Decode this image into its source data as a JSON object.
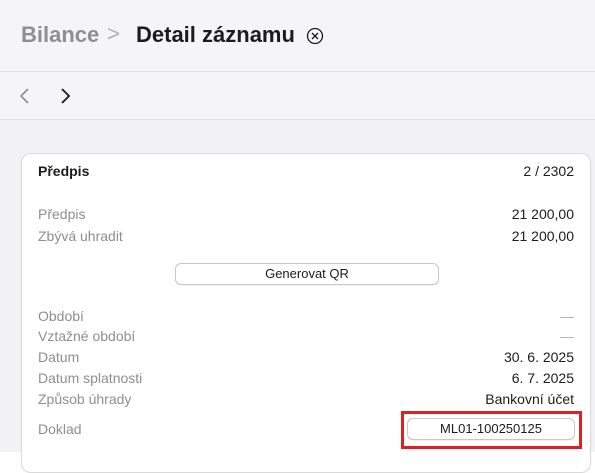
{
  "breadcrumb": {
    "parent": "Bilance",
    "separator": ">",
    "current": "Detail záznamu",
    "close_icon": "close-circle-icon"
  },
  "nav": {
    "back_icon": "chevron-left-icon",
    "forward_icon": "chevron-right-icon"
  },
  "record": {
    "title": "Předpis",
    "counter": "2 / 2302",
    "rows_top": [
      {
        "label": "Předpis",
        "value": "21 200,00"
      },
      {
        "label": "Zbývá uhradit",
        "value": "21 200,00"
      }
    ],
    "qr_button_label": "Generovat QR",
    "rows_bottom": [
      {
        "label": "Období",
        "value": "—"
      },
      {
        "label": "Vztažné období",
        "value": "—"
      },
      {
        "label": "Datum",
        "value": "30. 6. 2025"
      },
      {
        "label": "Datum splatnosti",
        "value": "6. 7. 2025"
      },
      {
        "label": "Způsob úhrady",
        "value": "Bankovní účet"
      }
    ],
    "doklad_label": "Doklad",
    "doklad_value": "ML01-100250125"
  },
  "colors": {
    "highlight": "#e02020",
    "label_gray": "#8e8e93"
  }
}
